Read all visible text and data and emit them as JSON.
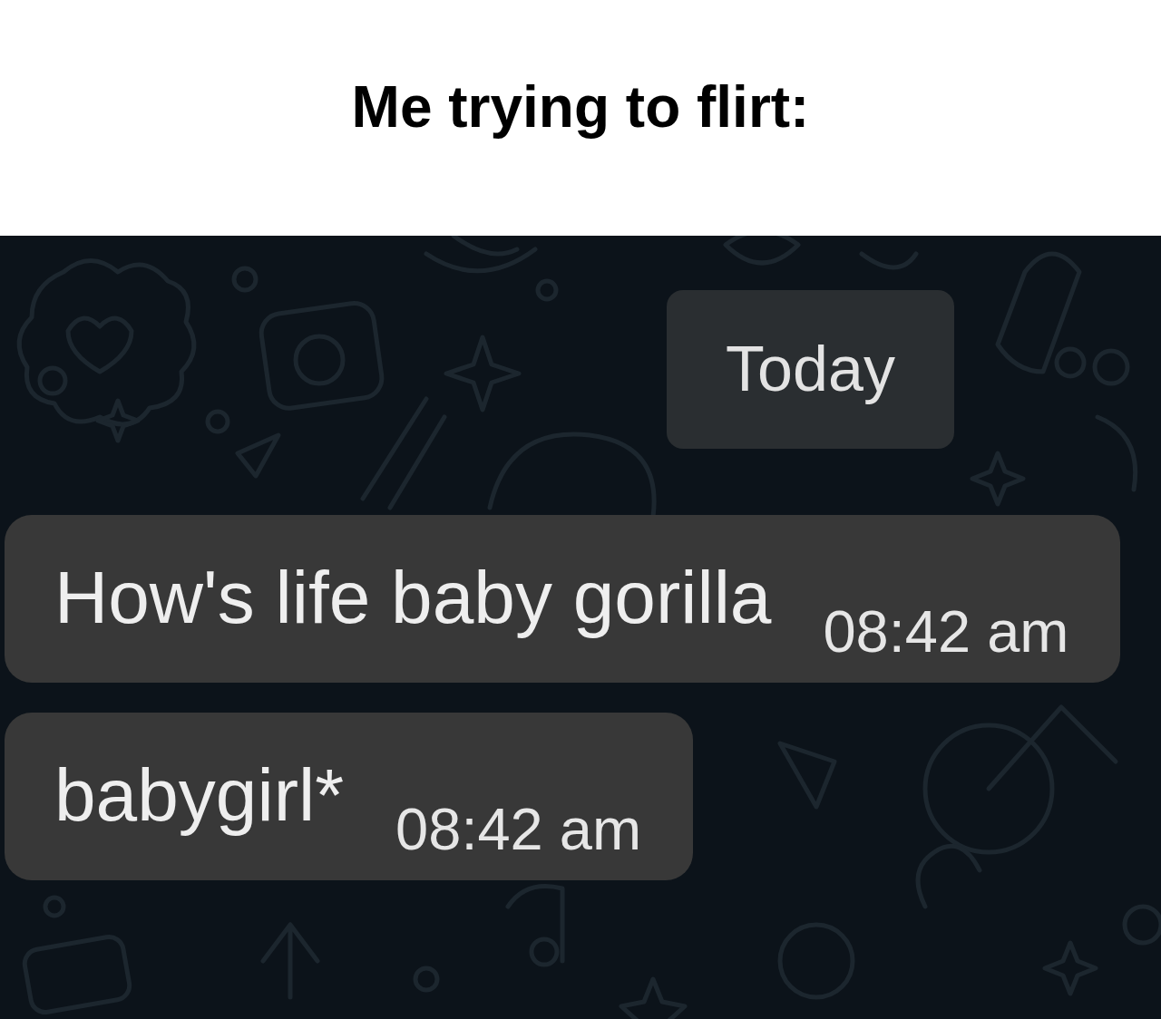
{
  "caption": "Me trying to flirt:",
  "chat": {
    "date_divider": "Today",
    "messages": [
      {
        "text": "How's life baby gorilla",
        "time": "08:42 am"
      },
      {
        "text": "babygirl*",
        "time": "08:42 am"
      }
    ]
  }
}
